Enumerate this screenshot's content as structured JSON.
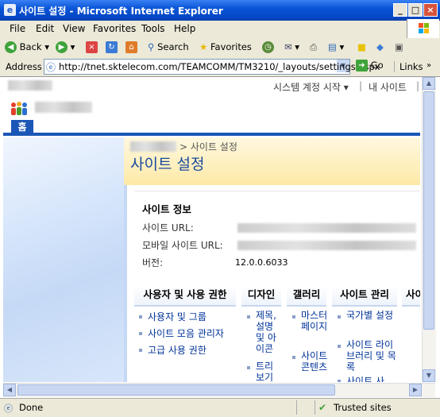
{
  "window": {
    "title": "사이트 설정 - Microsoft Internet Explorer"
  },
  "menu": [
    "File",
    "Edit",
    "View",
    "Favorites",
    "Tools",
    "Help"
  ],
  "toolbar": {
    "back": "Back",
    "search": "Search",
    "favorites": "Favorites"
  },
  "address": {
    "label": "Address",
    "url": "http://tnet.sktelecom.com/TEAMCOMM/TM3210/_layouts/settings.aspx",
    "go": "Go",
    "links": "Links"
  },
  "sharepoint": {
    "top_links": {
      "system_account": "시스템 계정 시작 ▾",
      "separator": "|",
      "my_site": "내 사이트",
      "separator2": "|"
    },
    "home_tab": "홈",
    "breadcrumb_tail": "> 사이트 설정",
    "page_title": "사이트 설정",
    "site_info": {
      "heading": "사이트 정보",
      "url_label": "사이트 URL:",
      "mobile_url_label": "모바일 사이트 URL:",
      "version_label": "버전:",
      "version_value": "12.0.0.6033"
    },
    "categories": [
      {
        "label": "사용자 및 사용 권한",
        "links": [
          "사용자 및 그룹",
          "사이트 모음 관리자",
          "고급 사용 권한"
        ]
      },
      {
        "label": "디자인",
        "links": [
          "제목, 설명 및 아이콘",
          "트리 보기"
        ]
      },
      {
        "label": "갤러리",
        "links": [
          "마스터 페이지",
          "사이트 콘텐츠"
        ]
      },
      {
        "label": "사이트 관리",
        "links": [
          "국가별 설정",
          "사이트 라이브러리 및 목록",
          "사이트 사"
        ]
      },
      {
        "label": "사이"
      }
    ]
  },
  "status": {
    "left": "Done",
    "zone": "Trusted sites"
  }
}
